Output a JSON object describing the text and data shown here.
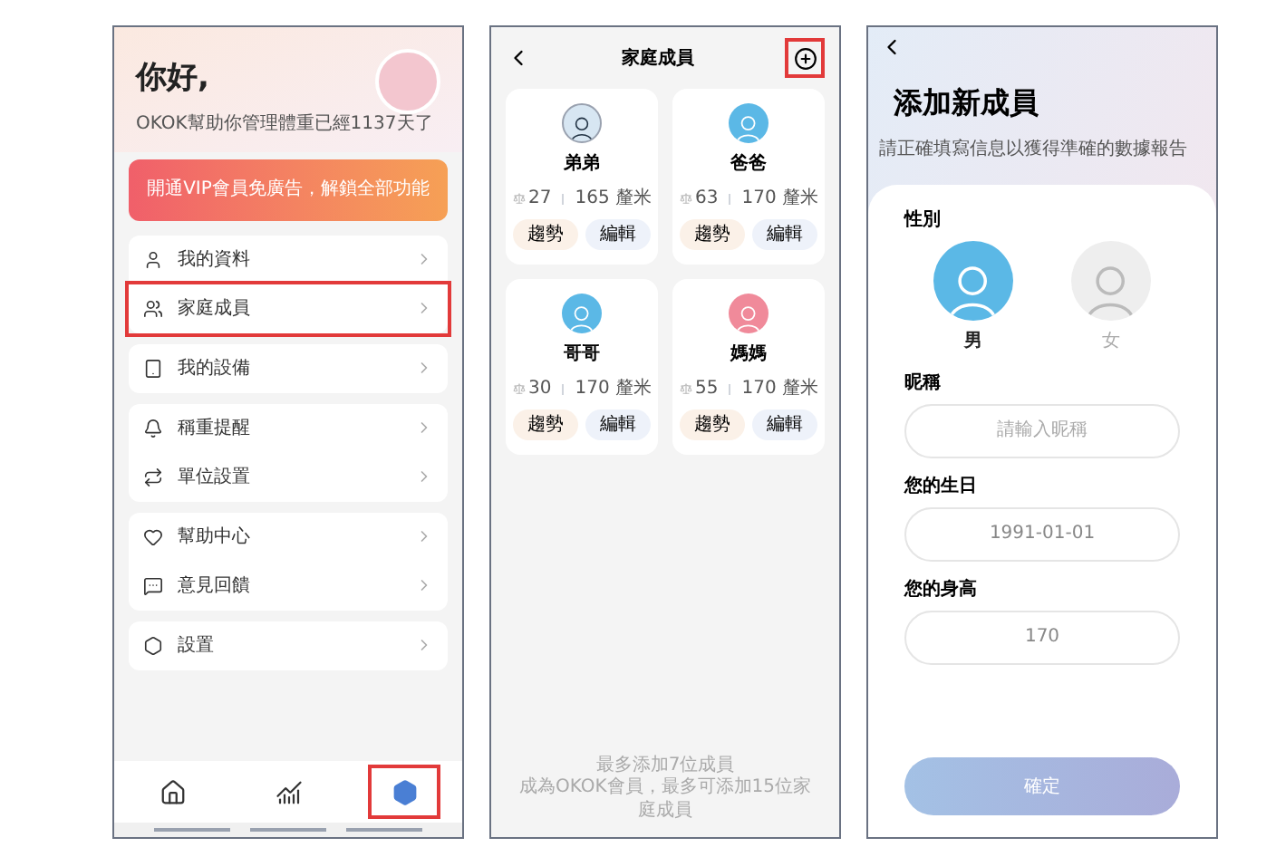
{
  "profile_screen": {
    "greeting": "你好,",
    "subtitle": "OKOK幫助你管理體重已經1137天了",
    "vip_banner": "開通VIP會員免廣告，解鎖全部功能",
    "menu_groups": [
      {
        "items": [
          {
            "label": "我的資料",
            "highlighted": false
          },
          {
            "label": "家庭成員",
            "highlighted": true
          }
        ]
      },
      {
        "items": [
          {
            "label": "我的設備",
            "highlighted": false
          }
        ]
      },
      {
        "items": [
          {
            "label": "稱重提醒",
            "highlighted": false
          },
          {
            "label": "單位設置",
            "highlighted": false
          }
        ]
      },
      {
        "items": [
          {
            "label": "幫助中心",
            "highlighted": false
          },
          {
            "label": "意見回饋",
            "highlighted": false
          }
        ]
      },
      {
        "items": [
          {
            "label": "設置",
            "highlighted": false
          }
        ]
      }
    ],
    "tabs": [
      {
        "selected": false,
        "highlighted": false
      },
      {
        "selected": false,
        "highlighted": false
      },
      {
        "selected": true,
        "highlighted": true
      }
    ]
  },
  "family_screen": {
    "title": "家庭成員",
    "add_highlighted": true,
    "members": [
      {
        "name": "弟弟",
        "kind": "photo",
        "weight": "27",
        "height": "165 釐米",
        "trend": "趨勢",
        "edit": "編輯"
      },
      {
        "name": "爸爸",
        "kind": "male",
        "weight": "63",
        "height": "170 釐米",
        "trend": "趨勢",
        "edit": "編輯"
      },
      {
        "name": "哥哥",
        "kind": "male",
        "weight": "30",
        "height": "170 釐米",
        "trend": "趨勢",
        "edit": "編輯"
      },
      {
        "name": "媽媽",
        "kind": "female",
        "weight": "55",
        "height": "170 釐米",
        "trend": "趨勢",
        "edit": "編輯"
      }
    ],
    "footer": [
      "最多添加7位成員",
      "成為OKOK會員，最多可添加15位家庭成員"
    ]
  },
  "add_member_screen": {
    "title": "添加新成員",
    "subtitle": "請正確填寫信息以獲得準確的數據報告",
    "gender_label": "性別",
    "genders": [
      {
        "label": "男",
        "selected": true
      },
      {
        "label": "女",
        "selected": false
      }
    ],
    "fields": [
      {
        "label": "昵稱",
        "placeholder": "請輸入昵稱"
      },
      {
        "label": "您的生日",
        "value": "1991-01-01"
      },
      {
        "label": "您的身高",
        "value": "170"
      }
    ],
    "confirm": "確定"
  }
}
